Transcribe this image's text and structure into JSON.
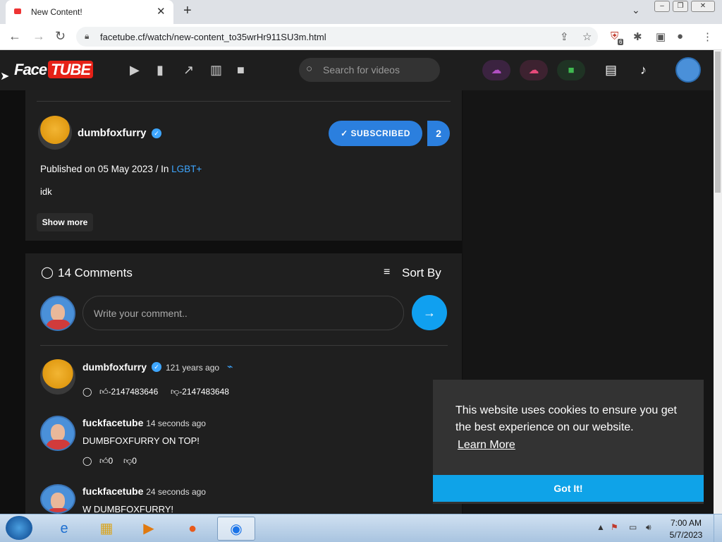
{
  "browser": {
    "tab_title": "New Content!",
    "tab_close": "✕",
    "new_tab": "+",
    "tab_menu": "⌄",
    "url": "facetube.cf/watch/new-content_to35wrHr911SU3m.html",
    "extension_badge": "6"
  },
  "site": {
    "logo_face": "Face",
    "logo_tube": "TUBE",
    "search_placeholder": "Search for videos"
  },
  "video": {
    "channel_name": "dumbfoxfurry",
    "subscribe_label": "SUBSCRIBED",
    "subscriber_count": "2",
    "published_prefix": "Published on 05 May 2023 / In ",
    "category": "LGBT+",
    "description": "idk",
    "show_more": "Show more"
  },
  "comments": {
    "title": "14 Comments",
    "sort_label": "Sort By",
    "input_placeholder": "Write your comment..",
    "items": [
      {
        "author": "dumbfoxfurry",
        "time": "121 years ago",
        "likes": "-2147483646",
        "dislikes": "-2147483648",
        "text": ""
      },
      {
        "author": "fuckfacetube",
        "time": "14 seconds ago",
        "text": "DUMBFOXFURRY ON TOP!",
        "likes": "0",
        "dislikes": "0"
      },
      {
        "author": "fuckfacetube",
        "time": "24 seconds ago",
        "text": "W DUMBFOXFURRY!"
      }
    ]
  },
  "cookie": {
    "text": "This website uses cookies to ensure you get the best experience on our website.",
    "learn_more": "Learn More",
    "ok": "Got It!"
  },
  "taskbar": {
    "time": "7:00 AM",
    "date": "5/7/2023"
  },
  "colors": {
    "accent": "#2b7fde",
    "link": "#3ea6ff",
    "cookie_button": "#0fa3e8"
  }
}
